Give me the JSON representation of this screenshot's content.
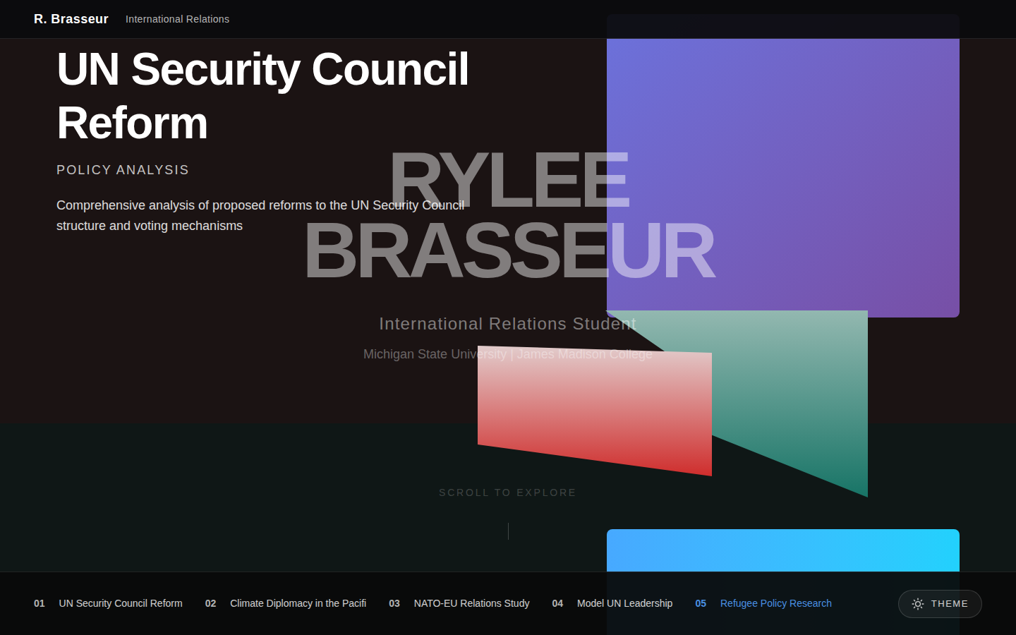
{
  "nav": {
    "brand": "R. Brasseur",
    "subtitle": "International Relations"
  },
  "project": {
    "title": "UN Security Council Reform",
    "category": "POLICY ANALYSIS",
    "description": "Comprehensive analysis of proposed reforms to the UN Security Council structure and voting mechanisms"
  },
  "hero": {
    "first": "RYLEE",
    "last": "BRASSEUR",
    "role": "International Relations Student",
    "school": "Michigan State University | James Madison College",
    "scroll": "SCROLL TO EXPLORE"
  },
  "projects": [
    {
      "number": "01",
      "title": "UN Security Council Reform",
      "selected": false
    },
    {
      "number": "02",
      "title": "Climate Diplomacy in the Pacifi",
      "selected": false
    },
    {
      "number": "03",
      "title": "NATO-EU Relations Study",
      "selected": false
    },
    {
      "number": "04",
      "title": "Model UN Leadership",
      "selected": false
    },
    {
      "number": "05",
      "title": "Refugee Policy Research",
      "selected": true
    }
  ],
  "theme": {
    "label": "THEME"
  }
}
